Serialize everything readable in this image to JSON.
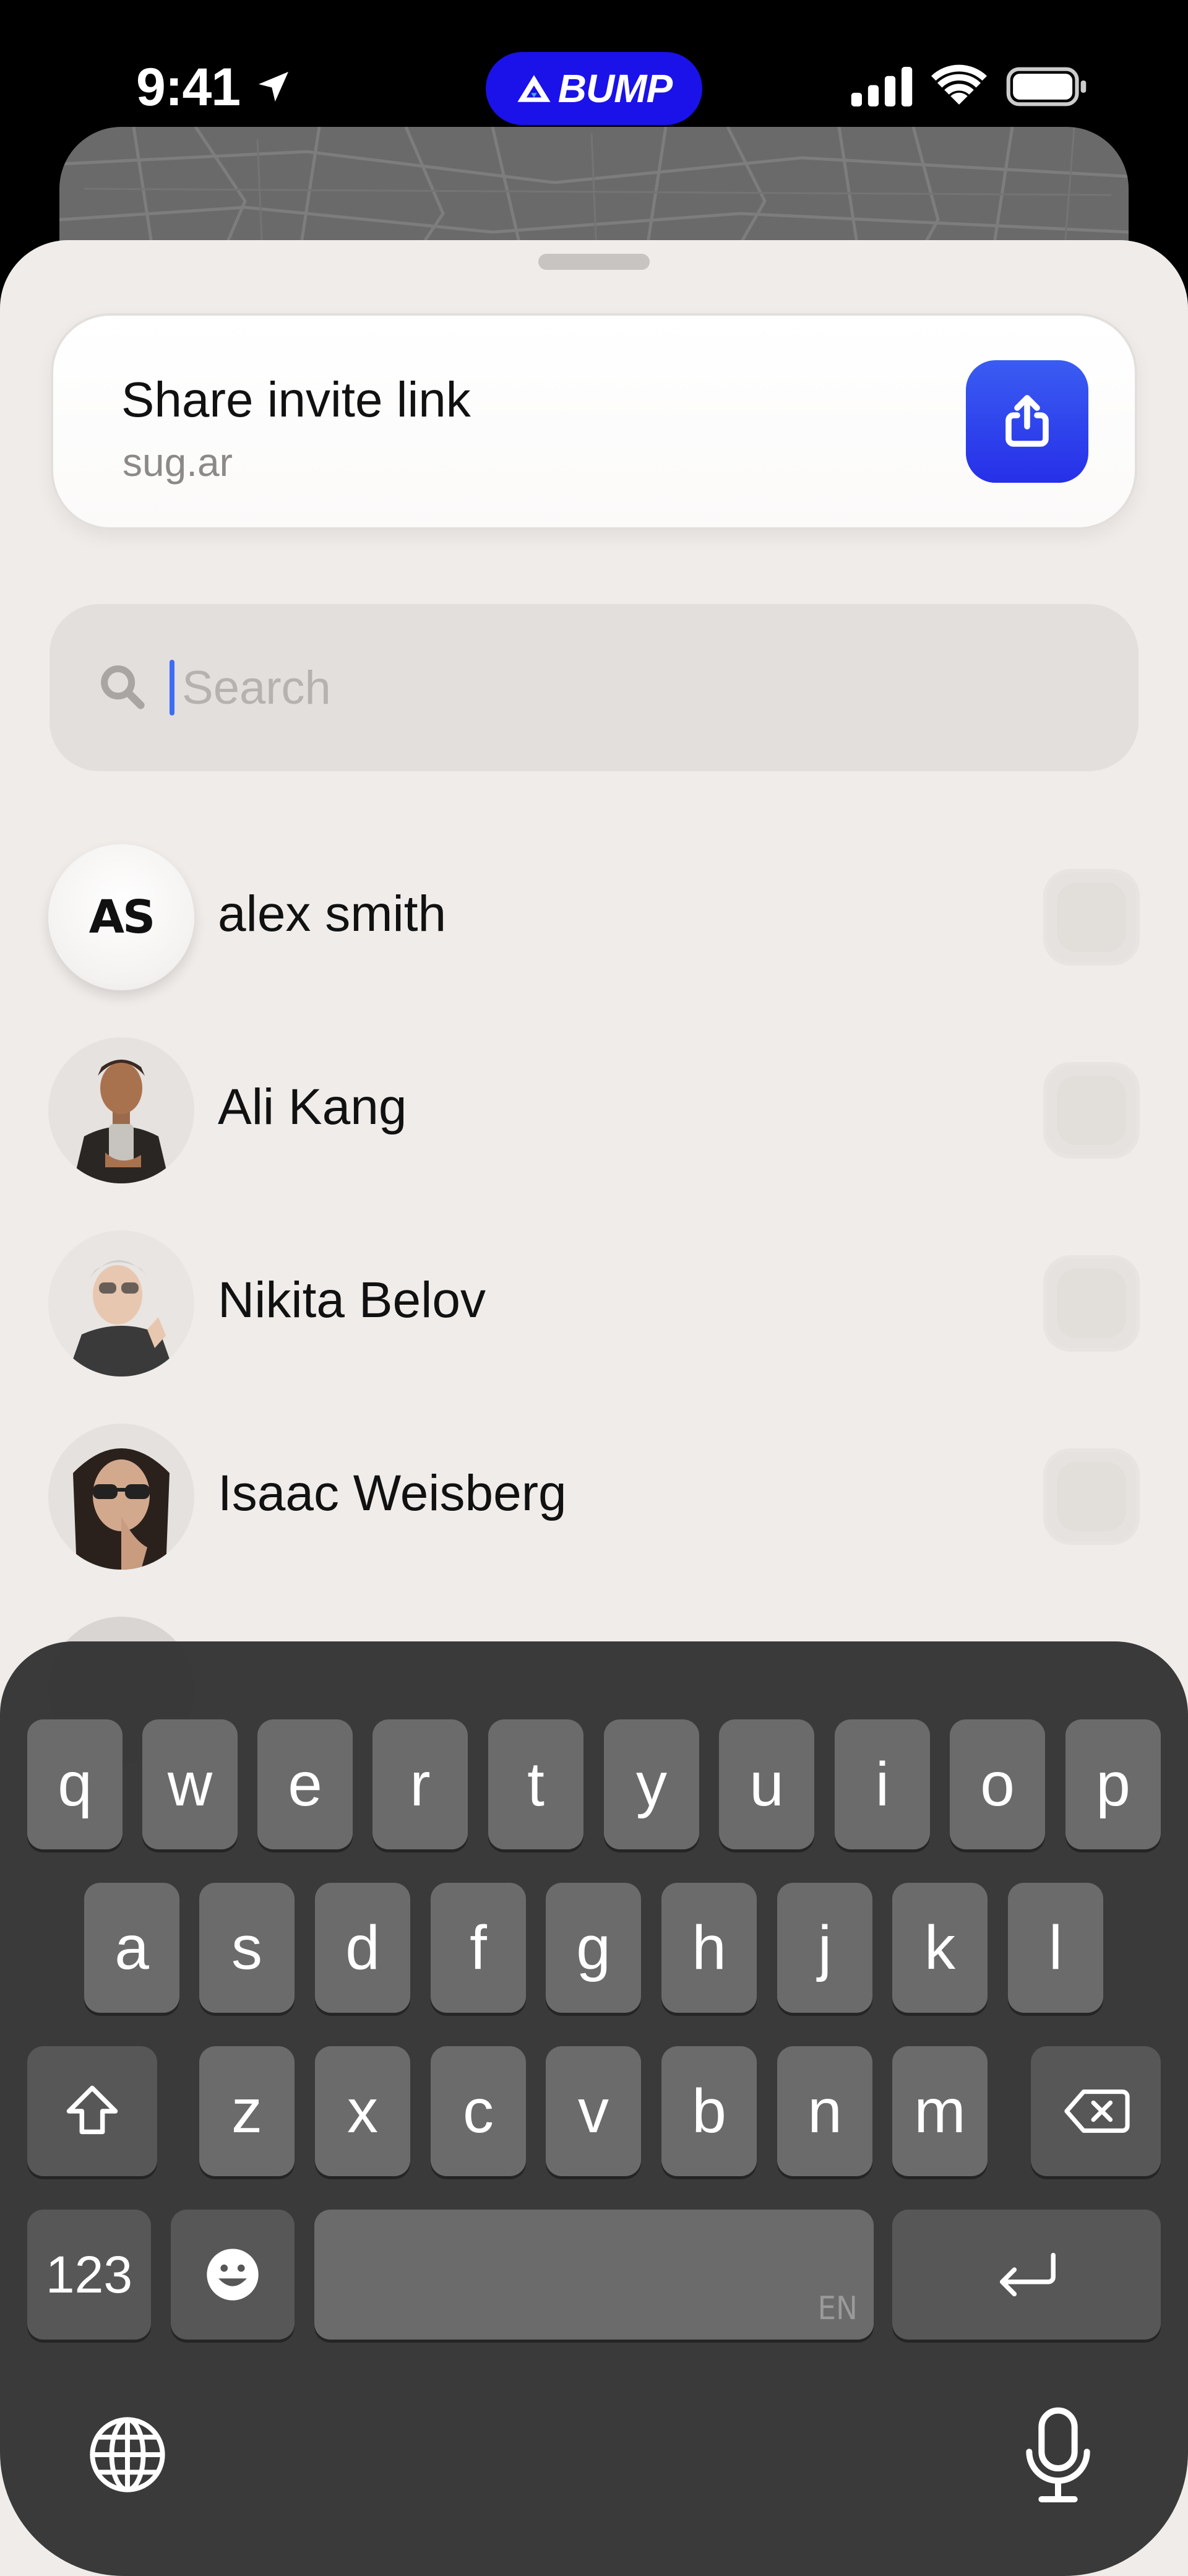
{
  "status_bar": {
    "time": "9:41",
    "app_pill": "BUMP",
    "accent": "#1a12e8"
  },
  "invite": {
    "title": "Share invite link",
    "subtitle": "sug.ar",
    "button_icon": "share-icon",
    "button_color": "#2a3be8"
  },
  "search": {
    "placeholder": "Search",
    "value": ""
  },
  "contacts": [
    {
      "name": "alex smith",
      "initials": "AS"
    },
    {
      "name": "Ali Kang",
      "initials": ""
    },
    {
      "name": "Nikita Belov",
      "initials": ""
    },
    {
      "name": "Isaac Weisberg",
      "initials": ""
    }
  ],
  "keyboard": {
    "row1": [
      "q",
      "w",
      "e",
      "r",
      "t",
      "y",
      "u",
      "i",
      "o",
      "p"
    ],
    "row2": [
      "a",
      "s",
      "d",
      "f",
      "g",
      "h",
      "j",
      "k",
      "l"
    ],
    "row3": [
      "z",
      "x",
      "c",
      "v",
      "b",
      "n",
      "m"
    ],
    "numbers_key": "123",
    "space_language": "EN",
    "icons": [
      "shift-icon",
      "backspace-icon",
      "emoji-icon",
      "return-icon",
      "globe-icon",
      "microphone-icon"
    ]
  }
}
